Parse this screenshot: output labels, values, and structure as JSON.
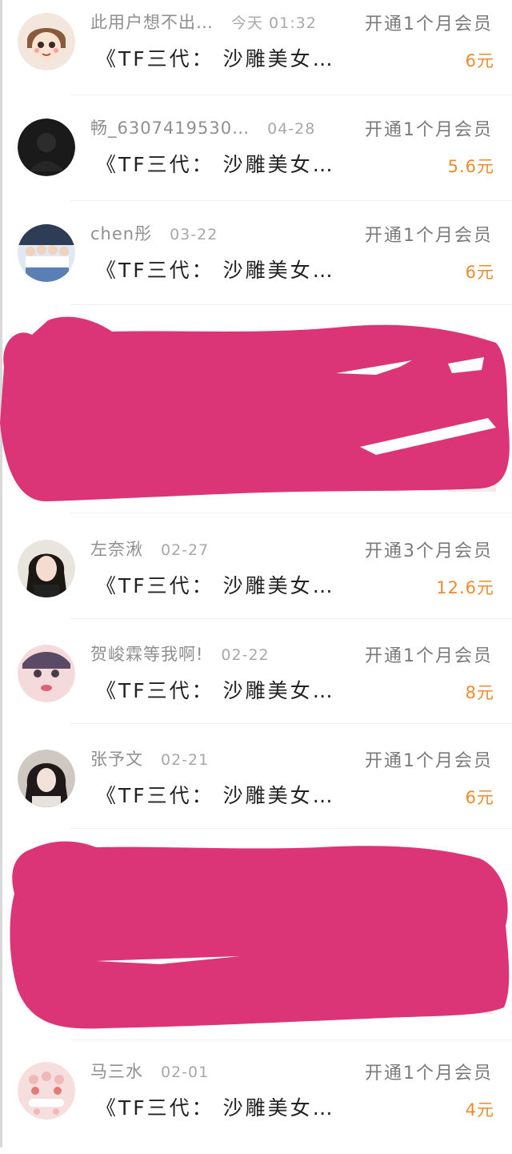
{
  "purchases": [
    {
      "user": "此用户想不出…",
      "date": "今天 01:32",
      "title": "《TF三代： 沙雕美女…",
      "plan": "开通1个月会员",
      "price": "6元",
      "avatar_icon": "cartoon-girl-avatar"
    },
    {
      "user": "畅_6307419530…",
      "date": "04-28",
      "title": "《TF三代： 沙雕美女…",
      "plan": "开通1个月会员",
      "price": "5.6元",
      "avatar_icon": "dark-photo-avatar"
    },
    {
      "user": "chen彤",
      "date": "03-22",
      "title": "《TF三代： 沙雕美女…",
      "plan": "开通1个月会员",
      "price": "6元",
      "avatar_icon": "group-photo-avatar"
    },
    {
      "user": "左奈湫",
      "date": "02-27",
      "title": "《TF三代： 沙雕美女…",
      "plan": "开通3个月会员",
      "price": "12.6元",
      "avatar_icon": "girl-portrait-avatar"
    },
    {
      "user": "贺峻霖等我啊!",
      "date": "02-22",
      "title": "《TF三代： 沙雕美女…",
      "plan": "开通1个月会员",
      "price": "8元",
      "avatar_icon": "face-closeup-avatar"
    },
    {
      "user": "张予文",
      "date": "02-21",
      "title": "《TF三代： 沙雕美女…",
      "plan": "开通1个月会员",
      "price": "6元",
      "avatar_icon": "girl-dark-hair-avatar"
    },
    {
      "user": "马三水",
      "date": "02-01",
      "title": "《TF三代： 沙雕美女…",
      "plan": "开通1个月会员",
      "price": "4元",
      "avatar_icon": "pink-happy-avatar"
    }
  ],
  "colors": {
    "price": "#f08a2a",
    "redaction": "#dc3577",
    "meta": "#8f8f8f"
  }
}
